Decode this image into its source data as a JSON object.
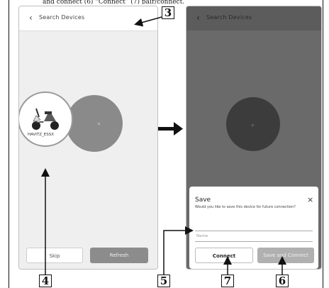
{
  "caption_cut": "and connect (6) “Connect” (7) pair/connect.",
  "screen1": {
    "back_icon": "‹",
    "title": "Search Devices",
    "device_name": "HAVITZ_ESSX",
    "skip_label": "Skip",
    "refresh_label": "Refresh"
  },
  "screen2": {
    "back_icon": "‹",
    "title": "Search Devices",
    "dialog_title": "Save",
    "dialog_close": "×",
    "dialog_text": "Would you like to save this device for future connection?",
    "name_placeholder": "Name",
    "connect_label": "Connect",
    "save_connect_label": "Save and Connect"
  },
  "callouts": [
    "3",
    "4",
    "5",
    "6",
    "7"
  ],
  "colors": {
    "scan_circle": "#8a8a8a",
    "scan_circle_dark": "#3c3c3c",
    "refresh_button": "#8c8c8c",
    "save_connect_button": "#b0b0b0"
  },
  "icons": {
    "bluetooth": "bluetooth-icon",
    "scooter": "scooter-icon",
    "arrow": "arrow-right-icon"
  }
}
